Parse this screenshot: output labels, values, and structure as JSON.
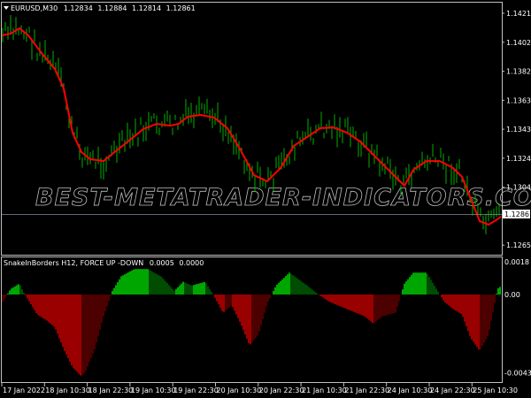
{
  "symbol_header": {
    "symbol": "EURUSD,M30",
    "open": "1.12834",
    "high": "1.12884",
    "low": "1.12814",
    "close": "1.12861"
  },
  "indicator_header": {
    "name": "SnakeInBorders H12, FORCE UP -DOWN",
    "value1": "0.0005",
    "value2": "0.0000"
  },
  "watermark": "BEST-METATRADER-INDICATORS.COM",
  "colors": {
    "background": "#000000",
    "bars": "#00b000",
    "ma": "#ff0000",
    "hist_up": "#00d000",
    "hist_up_fading": "#006000",
    "hist_down": "#c00000",
    "hist_down_fading": "#600000",
    "axis": "#c0c0c0"
  },
  "chart_data": [
    {
      "type": "line",
      "title": "EURUSD,M30",
      "price_axis_ticks": [
        "1.14215",
        "1.14020",
        "1.13825",
        "1.13630",
        "1.13435",
        "1.13240",
        "1.13045",
        "1.12655"
      ],
      "current_price": "1.12861",
      "ylim": [
        1.126,
        1.1445
      ],
      "ma_series": {
        "t": [
          0,
          10,
          20,
          30,
          45,
          60,
          70,
          80,
          90,
          100,
          115,
          130,
          145,
          160,
          175,
          190,
          200,
          210,
          225,
          240,
          255,
          270,
          285,
          300,
          315,
          330,
          345,
          360,
          375,
          390,
          405,
          420,
          430,
          445,
          455,
          465,
          480,
          495,
          510,
          520,
          530,
          540,
          550,
          560,
          565
        ],
        "price": [
          1.14066,
          1.14078,
          1.14114,
          1.14066,
          1.13947,
          1.1384,
          1.13709,
          1.13412,
          1.13281,
          1.13233,
          1.13221,
          1.13293,
          1.13364,
          1.13436,
          1.13471,
          1.13459,
          1.13471,
          1.13519,
          1.13531,
          1.13513,
          1.13442,
          1.13293,
          1.13126,
          1.13085,
          1.13174,
          1.13323,
          1.13382,
          1.13442,
          1.13447,
          1.13412,
          1.13352,
          1.13263,
          1.13203,
          1.13114,
          1.13055,
          1.13162,
          1.13221,
          1.13221,
          1.13174,
          1.13114,
          1.12966,
          1.12817,
          1.12793,
          1.12829,
          1.12852
        ]
      }
    },
    {
      "type": "bar",
      "title": "SnakeInBorders H12, FORCE UP -DOWN",
      "y_axis_ticks": [
        "0.0018",
        "0.00",
        "-0.0043"
      ],
      "ylim": [
        -0.0043,
        0.0018
      ],
      "series": {
        "t": [
          0,
          10,
          20,
          25,
          30,
          40,
          50,
          60,
          70,
          80,
          90,
          95,
          105,
          115,
          125,
          135,
          150,
          165,
          180,
          195,
          205,
          215,
          230,
          240,
          250,
          260,
          270,
          280,
          290,
          300,
          310,
          325,
          345,
          355,
          370,
          390,
          410,
          420,
          430,
          445,
          455,
          465,
          480,
          490,
          500,
          510,
          520,
          530,
          540,
          550,
          560,
          565
        ],
        "value": [
          -0.0005,
          0.0003,
          0.0006,
          0.0001,
          -0.0003,
          -0.0011,
          -0.0014,
          -0.0018,
          -0.003,
          -0.004,
          -0.0045,
          -0.0042,
          -0.003,
          -0.0012,
          0.0002,
          0.001,
          0.0014,
          0.0014,
          0.001,
          0.0002,
          0.0007,
          0.0005,
          0.0007,
          -0.0001,
          -0.001,
          -0.0006,
          -0.0016,
          -0.0028,
          -0.0022,
          -0.0005,
          0.0005,
          0.0012,
          0.0005,
          0.0001,
          -0.0004,
          -0.0008,
          -0.0012,
          -0.0016,
          -0.0012,
          -0.001,
          0.0006,
          0.0012,
          0.0012,
          0.0004,
          -0.0004,
          -0.0008,
          -0.0011,
          -0.0024,
          -0.0031,
          -0.0022,
          0.0003,
          0.0005
        ]
      }
    }
  ],
  "time_axis": [
    "17 Jan 2022",
    "18 Jan 10:30",
    "18 Jan 22:30",
    "19 Jan 10:30",
    "19 Jan 22:30",
    "20 Jan 10:30",
    "20 Jan 22:30",
    "21 Jan 10:30",
    "21 Jan 22:30",
    "24 Jan 10:30",
    "24 Jan 22:30",
    "25 Jan 10:30"
  ]
}
